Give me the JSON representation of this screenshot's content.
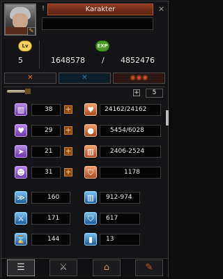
{
  "window": {
    "title": "Karakter",
    "name_value": ""
  },
  "header": {
    "level_badge": "Lv",
    "level_value": "5",
    "exp_badge": "EXP",
    "exp_current": "1648578",
    "exp_separator": "/",
    "exp_total": "4852476"
  },
  "tabs": [
    {
      "label": "✕"
    },
    {
      "label": "✕"
    },
    {
      "label": "◉◉◉"
    }
  ],
  "points": {
    "plus_label": "+",
    "value": "5"
  },
  "base_stats": [
    {
      "icon": "strength-icon",
      "value": "38"
    },
    {
      "icon": "health-icon",
      "value": "29"
    },
    {
      "icon": "dexterity-icon",
      "value": "21"
    },
    {
      "icon": "intelligence-icon",
      "value": "31"
    }
  ],
  "vitals": [
    {
      "icon": "hp-heart-icon",
      "value": "24162/24162"
    },
    {
      "icon": "mp-orb-icon",
      "value": "5454/6028"
    },
    {
      "icon": "attack-icon",
      "value": "2406-2524"
    },
    {
      "icon": "defense-shield-icon",
      "value": "1178"
    }
  ],
  "secondary_left": [
    {
      "icon": "speed-icon",
      "value": "160"
    },
    {
      "icon": "evasion-icon",
      "value": "171"
    },
    {
      "icon": "cast-speed-icon",
      "value": "144"
    }
  ],
  "secondary_right": [
    {
      "icon": "magic-attack-icon",
      "value": "912-974"
    },
    {
      "icon": "magic-defense-icon",
      "value": "617"
    },
    {
      "icon": "critical-icon",
      "value": "13"
    }
  ],
  "bottom_tabs": [
    {
      "icon": "character-sheet-icon"
    },
    {
      "icon": "crossed-swords-icon"
    },
    {
      "icon": "guild-icon"
    },
    {
      "icon": "skill-scroll-icon"
    }
  ]
}
